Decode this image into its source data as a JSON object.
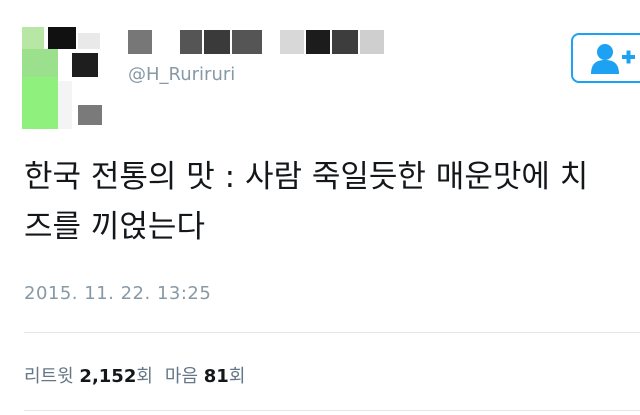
{
  "header": {
    "top_fragment": "",
    "handle": "@H_Ruriruri"
  },
  "tweet": {
    "line1": "한국 전통의 맛 : 사람 죽일듯한 매운맛에 치",
    "line2": "즈를 끼얹는다",
    "timestamp": "2015. 11. 22. 13:25"
  },
  "stats": {
    "retweets_label": "리트윗",
    "retweets_count": "2,152",
    "retweets_unit": "회",
    "likes_label": "마음",
    "likes_count": "81",
    "likes_unit": "회"
  },
  "colors": {
    "accent": "#1da1f2",
    "muted": "#8899a6"
  },
  "icons": {
    "follow": "add-user-icon"
  }
}
